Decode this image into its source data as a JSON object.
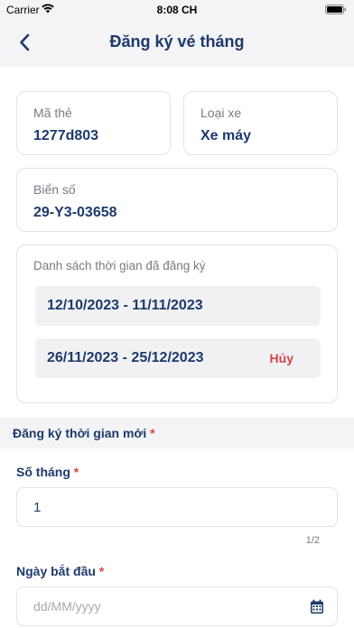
{
  "status_bar": {
    "carrier": "Carrier",
    "time": "8:08 CH"
  },
  "header": {
    "title": "Đăng ký vé tháng"
  },
  "card_code": {
    "label": "Mã thẻ",
    "value": "1277d803"
  },
  "vehicle_type": {
    "label": "Loại xe",
    "value": "Xe máy"
  },
  "plate": {
    "label": "Biển số",
    "value": "29-Y3-03658"
  },
  "registered": {
    "label": "Danh sách thời gian đã đăng ký",
    "periods": [
      {
        "range": "12/10/2023 - 11/11/2023"
      },
      {
        "range": "26/11/2023 - 25/12/2023",
        "action": "Hủy"
      }
    ]
  },
  "new_registration": {
    "title": "Đăng ký thời gian mới",
    "required_mark": "*",
    "months": {
      "label": "Số tháng",
      "value": "1",
      "counter": "1/2"
    },
    "start_date": {
      "label": "Ngày bắt đầu",
      "placeholder": "dd/MM/yyyy"
    }
  },
  "colors": {
    "primary": "#1d3a6b",
    "danger": "#d64545",
    "band": "#f4f4f6",
    "border": "#e3e3e8"
  },
  "icons": {
    "back": "chevron-left-icon",
    "calendar": "calendar-icon"
  }
}
